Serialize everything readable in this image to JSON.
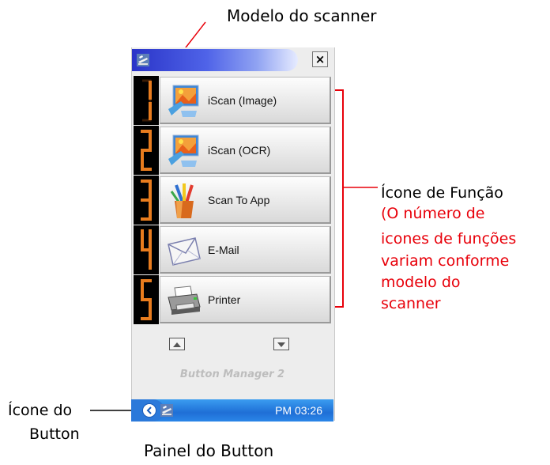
{
  "annotations": {
    "scanner_model": "Modelo do scanner",
    "function_icon": "Ícone de Função",
    "function_note_lines": [
      "(O número de",
      "icones de funções",
      "variam conforme",
      "modelo do",
      "scanner"
    ],
    "button_icon_lines": [
      "Ícone do",
      "Button"
    ],
    "panel_caption": "Painel do Button"
  },
  "panel": {
    "title": "",
    "close_label": "×",
    "functions": [
      {
        "number": "1",
        "label": "iScan (Image)",
        "icon": "image-scan-icon"
      },
      {
        "number": "2",
        "label": "iScan (OCR)",
        "icon": "ocr-scan-icon"
      },
      {
        "number": "3",
        "label": "Scan To App",
        "icon": "paint-brushes-icon"
      },
      {
        "number": "4",
        "label": "E-Mail",
        "icon": "envelope-icon"
      },
      {
        "number": "5",
        "label": "Printer",
        "icon": "printer-icon"
      }
    ],
    "app_name": "Button Manager 2"
  },
  "taskbar": {
    "clock": "PM 03:26"
  },
  "colors": {
    "annotation_red": "#e8000a",
    "digit_orange": "#e87c1e",
    "taskbar_blue": "#1f6fd6"
  }
}
